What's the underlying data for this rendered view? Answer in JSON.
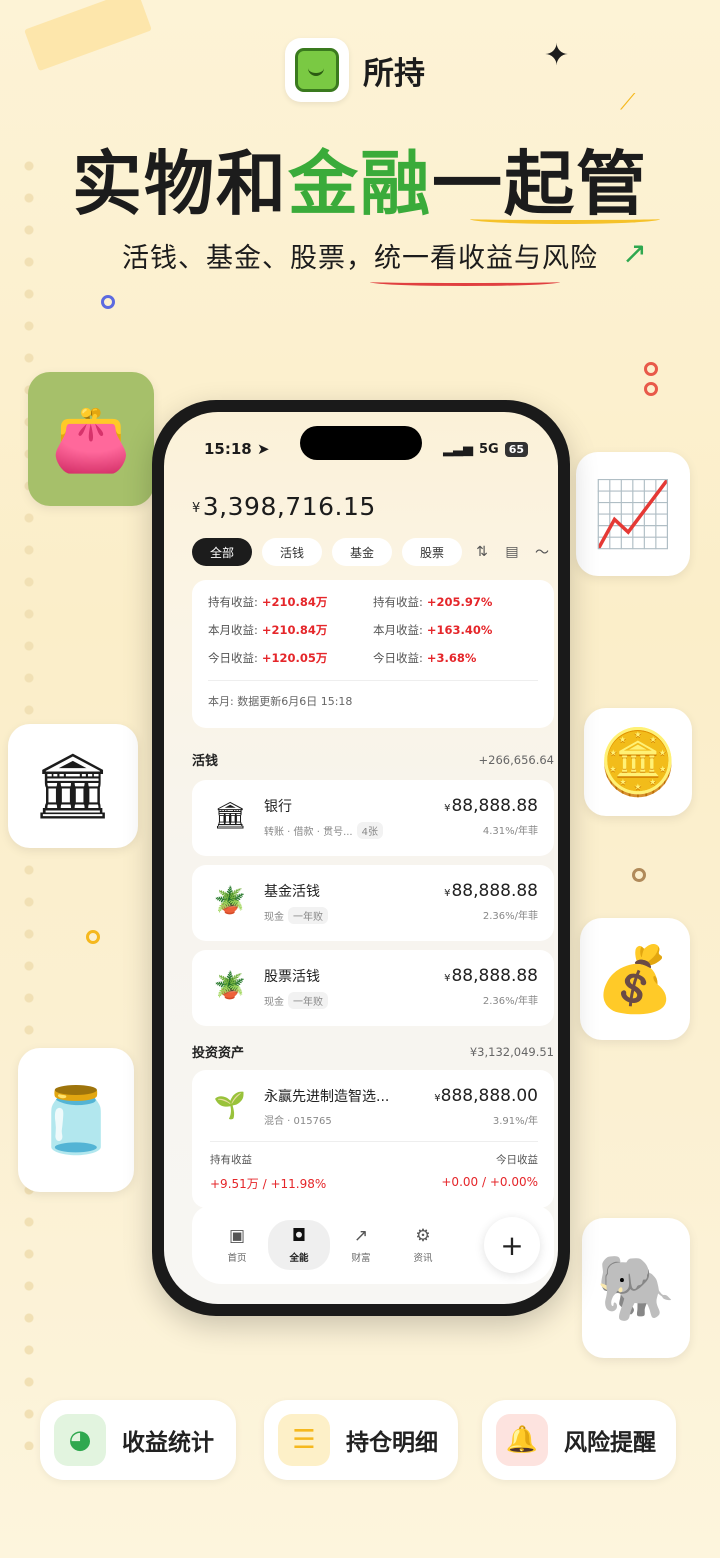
{
  "app": {
    "name": "所持"
  },
  "headline": {
    "part1": "实物和",
    "part2": "金融",
    "part3": "一起管"
  },
  "subline": "活钱、基金、股票，统一看收益与风险",
  "status_bar": {
    "time": "15:18",
    "signal": "5G",
    "battery": "65"
  },
  "summary": {
    "currency": "¥",
    "total": "3,398,716.15"
  },
  "filters": [
    "全部",
    "活钱",
    "基金",
    "股票"
  ],
  "stats": {
    "hold_profit_label": "持有收益:",
    "hold_profit": "+210.84万",
    "hold_rate_label": "持有收益:",
    "hold_rate": "+205.97%",
    "month_profit_label": "本月收益:",
    "month_profit": "+210.84万",
    "month_rate_label": "本月收益:",
    "month_rate": "+163.40%",
    "today_profit_label": "今日收益:",
    "today_profit": "+120.05万",
    "today_rate_label": "今日收益:",
    "today_rate": "+3.68%",
    "note": "本月:   数据更新6月6日 15:18"
  },
  "cash": {
    "title": "活钱",
    "amount": "+266,656.64",
    "accounts": [
      {
        "name": "银行",
        "tags": "转账 · 借款 · 贯号...",
        "pill": "4张",
        "currency": "¥",
        "amount": "88,888.88",
        "rate": "4.31%/年菲"
      },
      {
        "name": "基金活钱",
        "tags": "现金",
        "pill": "一年败",
        "currency": "¥",
        "amount": "88,888.88",
        "rate": "2.36%/年菲"
      },
      {
        "name": "股票活钱",
        "tags": "现金",
        "pill": "一年败",
        "currency": "¥",
        "amount": "88,888.88",
        "rate": "2.36%/年菲"
      }
    ]
  },
  "investment": {
    "title": "投资资产",
    "amount": "¥3,132,049.51",
    "item": {
      "name": "永赢先进制造智选...",
      "tags": "混合 · 015765",
      "currency": "¥",
      "amount": "888,888.00",
      "rate": "3.91%/年",
      "hold_label": "持有收益",
      "today_label": "今日收益",
      "hold_value": "+9.51万 / +11.98%",
      "today_value": "+0.00 / +0.00%"
    }
  },
  "tabbar": {
    "home": "首页",
    "all": "全能",
    "wealth": "财富",
    "news": "资讯",
    "add": "+"
  },
  "features": [
    {
      "label": "收益统计",
      "icon": "pie-chart-icon",
      "color": "#2fa84f"
    },
    {
      "label": "持仓明细",
      "icon": "list-icon",
      "color": "#f5b81e"
    },
    {
      "label": "风险提醒",
      "icon": "bell-icon",
      "color": "#e85a4a"
    }
  ]
}
